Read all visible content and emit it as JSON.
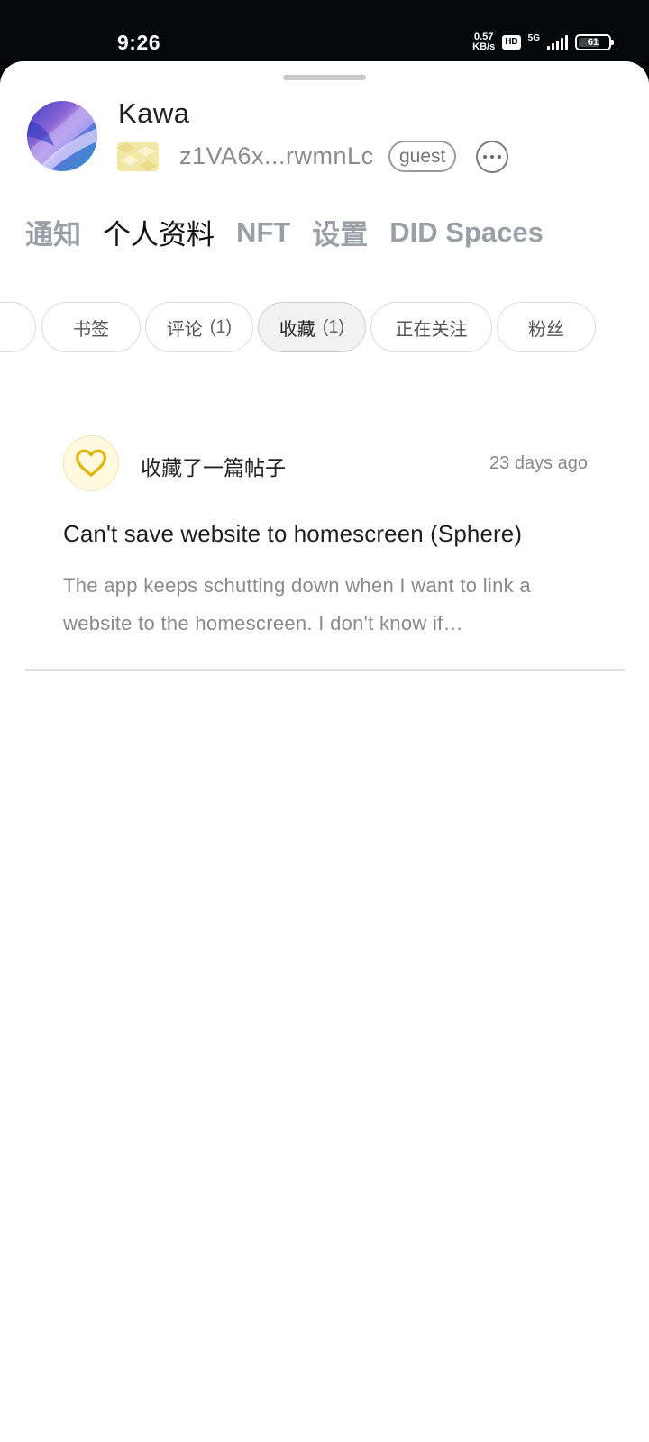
{
  "status_bar": {
    "time": "9:26",
    "net_speed_value": "0.57",
    "net_speed_unit": "KB/s",
    "hd": "HD",
    "network": "5G",
    "battery": "61"
  },
  "profile": {
    "name": "Kawa",
    "did": "z1VA6x...rwmnLc",
    "role": "guest"
  },
  "main_tabs": [
    {
      "label": "通知"
    },
    {
      "label": "个人资料"
    },
    {
      "label": "NFT"
    },
    {
      "label": "设置"
    },
    {
      "label": "DID Spaces"
    }
  ],
  "filter_chips": [
    {
      "label": "书签",
      "count": ""
    },
    {
      "label": "评论",
      "count": "(1)"
    },
    {
      "label": "收藏",
      "count": "(1)"
    },
    {
      "label": "正在关注",
      "count": ""
    },
    {
      "label": "粉丝",
      "count": ""
    }
  ],
  "activity": {
    "action": "收藏了一篇帖子",
    "time": "23 days ago",
    "post_title": "Can't save website to homescreen (Sphere)",
    "post_excerpt": "The app keeps schutting down when I want to link a website to the homescreen. I don't know if…"
  },
  "colors": {
    "heart": "#e0b400",
    "heart_bg": "#fff9df",
    "inactive_tab": "#9ba0a6"
  }
}
